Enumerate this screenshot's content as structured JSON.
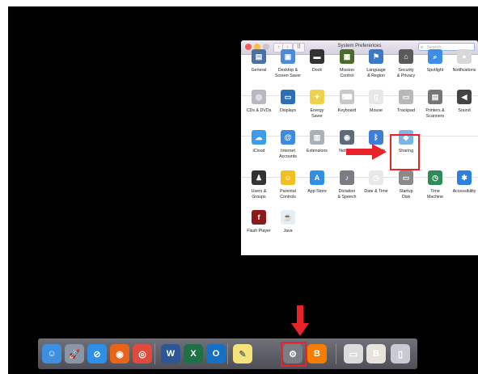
{
  "window": {
    "title": "System Preferences",
    "search_placeholder": "Search",
    "nav_back": "‹",
    "nav_forward": "›",
    "grid_glyph": "⠿"
  },
  "rows": [
    [
      {
        "label": "General",
        "icon": "general-icon"
      },
      {
        "label": "Desktop &\nScreen Saver",
        "icon": "desktop-screensaver-icon"
      },
      {
        "label": "Dock",
        "icon": "dock-icon"
      },
      {
        "label": "Mission\nControl",
        "icon": "mission-control-icon"
      },
      {
        "label": "Language\n& Region",
        "icon": "language-region-icon"
      },
      {
        "label": "Security\n& Privacy",
        "icon": "security-privacy-icon"
      },
      {
        "label": "Spotlight",
        "icon": "spotlight-icon"
      },
      {
        "label": "Notifications",
        "icon": "notifications-icon"
      }
    ],
    [
      {
        "label": "CDs & DVDs",
        "icon": "cds-dvds-icon"
      },
      {
        "label": "Displays",
        "icon": "displays-icon"
      },
      {
        "label": "Energy\nSaver",
        "icon": "energy-saver-icon"
      },
      {
        "label": "Keyboard",
        "icon": "keyboard-icon"
      },
      {
        "label": "Mouse",
        "icon": "mouse-icon"
      },
      {
        "label": "Trackpad",
        "icon": "trackpad-icon"
      },
      {
        "label": "Printers &\nScanners",
        "icon": "printers-scanners-icon"
      },
      {
        "label": "Sound",
        "icon": "sound-icon"
      }
    ],
    [
      {
        "label": "iCloud",
        "icon": "icloud-icon"
      },
      {
        "label": "Internet\nAccounts",
        "icon": "internet-accounts-icon"
      },
      {
        "label": "Extensions",
        "icon": "extensions-icon"
      },
      {
        "label": "Network",
        "icon": "network-icon"
      },
      {
        "label": "Bluetooth",
        "icon": "bluetooth-icon"
      },
      {
        "label": "Sharing",
        "icon": "sharing-icon"
      }
    ],
    [
      {
        "label": "Users &\nGroups",
        "icon": "users-groups-icon"
      },
      {
        "label": "Parental\nControls",
        "icon": "parental-controls-icon"
      },
      {
        "label": "App Store",
        "icon": "app-store-icon"
      },
      {
        "label": "Dictation\n& Speech",
        "icon": "dictation-speech-icon"
      },
      {
        "label": "Date & Time",
        "icon": "date-time-icon"
      },
      {
        "label": "Startup\nDisk",
        "icon": "startup-disk-icon"
      },
      {
        "label": "Time\nMachine",
        "icon": "time-machine-icon"
      },
      {
        "label": "Accessibility",
        "icon": "accessibility-icon"
      }
    ],
    [
      {
        "label": "Flash Player",
        "icon": "flash-player-icon"
      },
      {
        "label": "Java",
        "icon": "java-icon"
      }
    ]
  ],
  "dock": [
    {
      "name": "finder",
      "glyph": "☺",
      "color": "#3d8fe0"
    },
    {
      "name": "launchpad",
      "glyph": "🚀",
      "color": "#8a96a8"
    },
    {
      "name": "safari",
      "glyph": "⊘",
      "color": "#2d8fe8"
    },
    {
      "name": "firefox",
      "glyph": "◉",
      "color": "#e8641b"
    },
    {
      "name": "chrome",
      "glyph": "◎",
      "color": "#de4b3a"
    },
    {
      "name": "word",
      "glyph": "W",
      "color": "#2b5797"
    },
    {
      "name": "excel",
      "glyph": "X",
      "color": "#1e7145"
    },
    {
      "name": "outlook",
      "glyph": "O",
      "color": "#1770c4"
    },
    {
      "name": "notes",
      "glyph": "✎",
      "color": "#f4e27a"
    },
    {
      "name": "system-preferences",
      "glyph": "⚙",
      "color": "#7b7d84"
    },
    {
      "name": "blogger",
      "glyph": "B",
      "color": "#f57d00"
    },
    {
      "name": "downloads",
      "glyph": "▭",
      "color": "#dcdcdc"
    },
    {
      "name": "document-stack",
      "glyph": "B",
      "color": "#e8e2dc"
    },
    {
      "name": "trash",
      "glyph": "▯",
      "color": "#c8ccd2"
    }
  ],
  "colors": {
    "highlight": "#e8232a",
    "desktop": "#000000",
    "dock": "#5d5e66"
  }
}
